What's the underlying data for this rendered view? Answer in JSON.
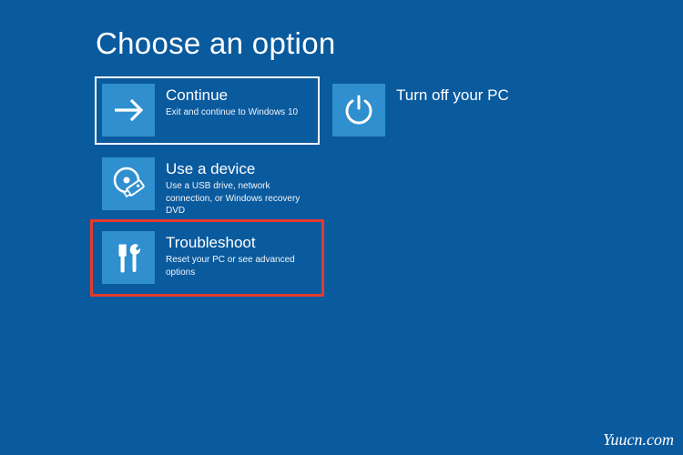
{
  "title": "Choose an option",
  "tiles": {
    "continue": {
      "title": "Continue",
      "desc": "Exit and continue to Windows 10"
    },
    "turnoff": {
      "title": "Turn off your PC",
      "desc": ""
    },
    "usedevice": {
      "title": "Use a device",
      "desc": "Use a USB drive, network connection, or Windows recovery DVD"
    },
    "troubleshoot": {
      "title": "Troubleshoot",
      "desc": "Reset your PC or see advanced options"
    }
  },
  "watermark": "Yuucn.com",
  "colors": {
    "background": "#0a5a9e",
    "tile_icon_bg": "#2f8fcf",
    "highlight": "#e63a2d"
  }
}
